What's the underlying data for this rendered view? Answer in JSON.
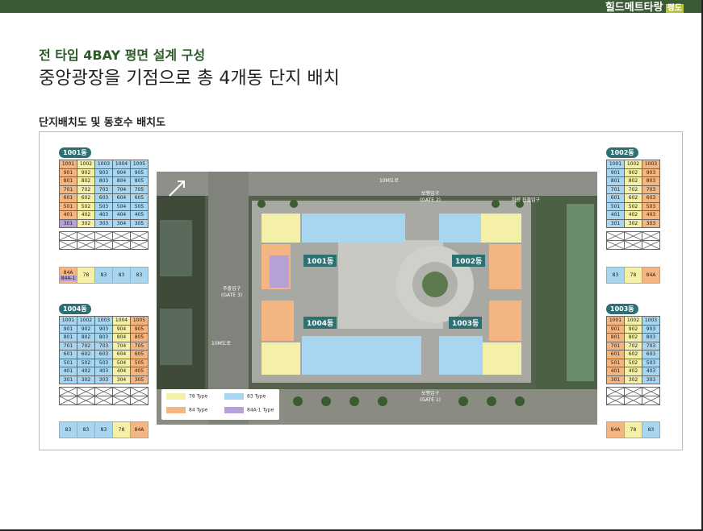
{
  "header": {
    "brand": "힐드메트타랑",
    "badge": "평도"
  },
  "subtitle": "전 타입 4BAY 평면 설계 구성",
  "title": "중앙광장을 기점으로 총 4개동 단지 배치",
  "section_label": "단지배치도 및 동호수 배치도",
  "colors": {
    "type78": "#f4f0a8",
    "type83": "#a8d6f0",
    "type84": "#f3b582",
    "type84a1": "#b7a0d6",
    "header": "#3d5a36",
    "badge": "#2e6f74"
  },
  "buildings": {
    "b1001": {
      "label": "1001동",
      "rows": [
        [
          "1001",
          "1002",
          "1003",
          "1004",
          "1005"
        ],
        [
          "901",
          "902",
          "903",
          "904",
          "905"
        ],
        [
          "801",
          "802",
          "803",
          "804",
          "805"
        ],
        [
          "701",
          "702",
          "703",
          "704",
          "705"
        ],
        [
          "601",
          "602",
          "603",
          "604",
          "605"
        ],
        [
          "501",
          "502",
          "503",
          "504",
          "505"
        ],
        [
          "401",
          "402",
          "403",
          "404",
          "405"
        ],
        [
          "301",
          "302",
          "303",
          "304",
          "305"
        ]
      ],
      "types": [
        "84A",
        "78",
        "83",
        "83",
        "83"
      ],
      "types_sub": "84A-1"
    },
    "b1002": {
      "label": "1002동",
      "rows": [
        [
          "1001",
          "1002",
          "1003"
        ],
        [
          "901",
          "902",
          "903"
        ],
        [
          "801",
          "802",
          "803"
        ],
        [
          "701",
          "702",
          "703"
        ],
        [
          "601",
          "602",
          "603"
        ],
        [
          "501",
          "502",
          "503"
        ],
        [
          "401",
          "402",
          "403"
        ],
        [
          "301",
          "302",
          "303"
        ]
      ],
      "types": [
        "83",
        "78",
        "84A"
      ]
    },
    "b1004": {
      "label": "1004동",
      "rows": [
        [
          "1001",
          "1002",
          "1003",
          "1004",
          "1005"
        ],
        [
          "901",
          "902",
          "903",
          "904",
          "905"
        ],
        [
          "801",
          "802",
          "803",
          "804",
          "805"
        ],
        [
          "701",
          "702",
          "703",
          "704",
          "705"
        ],
        [
          "601",
          "602",
          "603",
          "604",
          "605"
        ],
        [
          "501",
          "502",
          "503",
          "504",
          "505"
        ],
        [
          "401",
          "402",
          "403",
          "404",
          "405"
        ],
        [
          "301",
          "302",
          "303",
          "304",
          "305"
        ]
      ],
      "types": [
        "83",
        "83",
        "83",
        "78",
        "84A"
      ]
    },
    "b1003": {
      "label": "1003동",
      "rows": [
        [
          "1001",
          "1002",
          "1003"
        ],
        [
          "901",
          "902",
          "903"
        ],
        [
          "801",
          "802",
          "803"
        ],
        [
          "701",
          "702",
          "703"
        ],
        [
          "601",
          "602",
          "603"
        ],
        [
          "501",
          "502",
          "503"
        ],
        [
          "401",
          "402",
          "403"
        ],
        [
          "301",
          "302",
          "303"
        ]
      ],
      "types": [
        "84A",
        "78",
        "83"
      ]
    }
  },
  "map": {
    "road_top": "10M도로",
    "road_left": "10M도로",
    "gate2": "보행입구\n(GATE 2)",
    "gate3": "주출입구\n(GATE 3)",
    "gate1": "보행입구\n(GATE 1)",
    "gate4": "차량 진출입구",
    "labels": {
      "b1001": "1001동",
      "b1002": "1002동",
      "b1003": "1003동",
      "b1004": "1004동"
    }
  },
  "legend": {
    "t78": "78 Type",
    "t83": "83 Type",
    "t84": "84 Type",
    "t84a1": "84A-1 Type"
  }
}
